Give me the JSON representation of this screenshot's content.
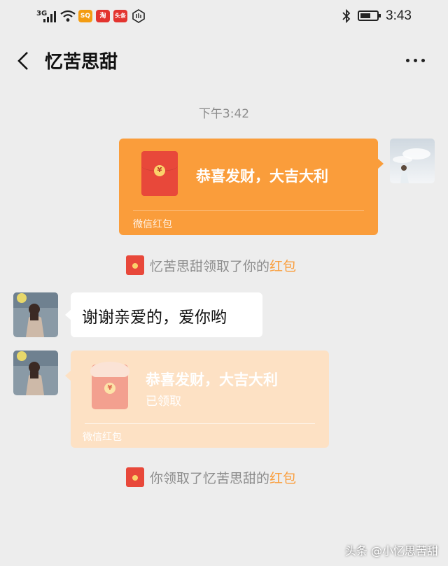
{
  "status_bar": {
    "network": "3G",
    "app_badges": [
      "SQ",
      "淘",
      "头条"
    ],
    "time": "3:43",
    "icons": [
      "signal-icon",
      "wifi-icon",
      "bluetooth-icon",
      "battery-icon"
    ]
  },
  "header": {
    "back_icon": "chevron-left-icon",
    "title": "忆苦思甜",
    "more_icon": "more-dots-icon"
  },
  "chat": {
    "timestamp": "下午3:42",
    "sent_packet": {
      "greeting": "恭喜发财，大吉大利",
      "footer": "微信红包",
      "currency": "¥"
    },
    "notice_1": {
      "prefix": "忆苦思甜领取了你的",
      "highlight": "红包"
    },
    "received_text": "谢谢亲爱的，爱你哟",
    "opened_packet": {
      "greeting": "恭喜发财，大吉大利",
      "status": "已领取",
      "footer": "微信红包",
      "currency": "¥"
    },
    "notice_2": {
      "prefix": "你领取了忆苦思甜的",
      "highlight": "红包"
    }
  },
  "watermark": "头条 @小忆思苦甜",
  "colors": {
    "background": "#ededed",
    "packet_orange": "#fa9d3b",
    "packet_opened": "#fde1c4",
    "envelope_red": "#e8483a"
  }
}
